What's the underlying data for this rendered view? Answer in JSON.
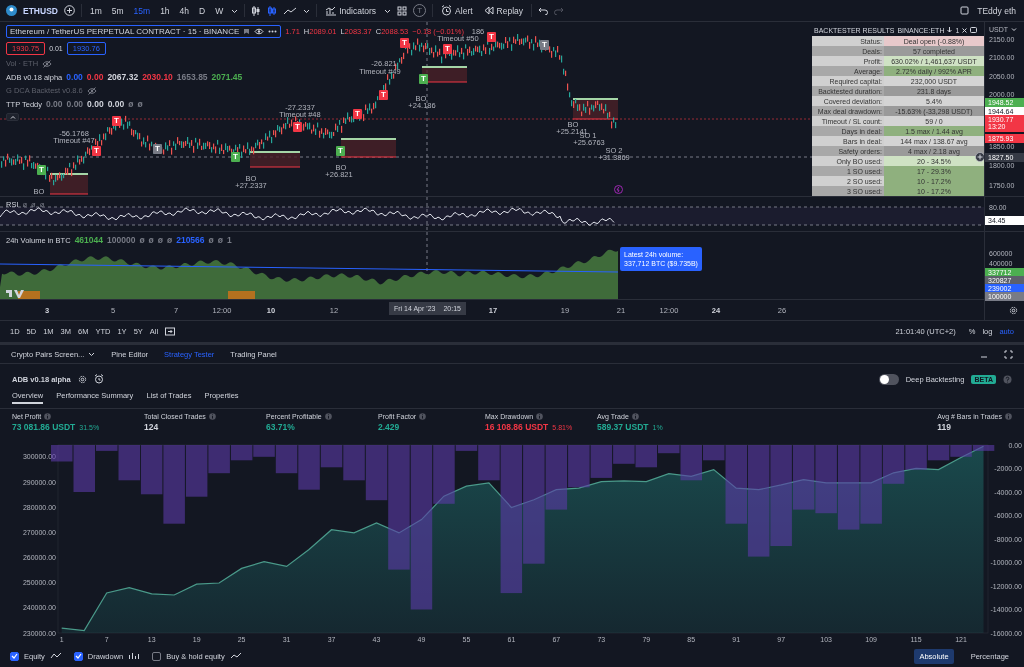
{
  "toolbar": {
    "symbol": "ETHUSD",
    "intervals": [
      {
        "label": "1m",
        "selected": false
      },
      {
        "label": "5m",
        "selected": false
      },
      {
        "label": "15m",
        "selected": true
      },
      {
        "label": "1h",
        "selected": false
      },
      {
        "label": "4h",
        "selected": false
      },
      {
        "label": "D",
        "selected": false
      },
      {
        "label": "W",
        "selected": false
      }
    ],
    "indicators_label": "Indicators",
    "templates_letter": "T",
    "alert_label": "Alert",
    "replay_label": "Replay",
    "user": "TEddy eth"
  },
  "chart": {
    "title": "Ethereum / TetherUS PERPETUAL CONTRACT · 15 · BINANCE",
    "open_fragment": "1.71",
    "ohlc": [
      {
        "label": "H",
        "value": "2089.01"
      },
      {
        "label": "L",
        "value": "2083.37"
      },
      {
        "label": "C",
        "value": "2088.53"
      }
    ],
    "change": "−0.18 (−0.01%)",
    "bid": "1930.75",
    "spread": "0.01",
    "ask": "1930.76",
    "indicators": [
      {
        "name": "Vol · ETH",
        "hidden": true
      },
      {
        "name": "ADB v0.18 alpha",
        "hidden": false,
        "values": [
          {
            "text": "0.00",
            "color": "#2962ff"
          },
          {
            "text": "0.00",
            "color": "#f23645"
          },
          {
            "text": "2067.32",
            "color": "#d1d4dc"
          },
          {
            "text": "2030.10",
            "color": "#f23645"
          },
          {
            "text": "1653.85",
            "color": "#787b86"
          },
          {
            "text": "2071.45",
            "color": "#4caf50"
          }
        ]
      },
      {
        "name": "G DCA Backtest v0.8.6",
        "hidden": true
      },
      {
        "name": "TTP Teddy",
        "hidden": false,
        "values": [
          {
            "text": "0.00",
            "color": "#787b86"
          },
          {
            "text": "0.00",
            "color": "#787b86"
          },
          {
            "text": "0.00",
            "color": "#d1d4dc"
          },
          {
            "text": "0.00",
            "color": "#d1d4dc"
          },
          {
            "text": "ø",
            "color": "#787b86"
          },
          {
            "text": "ø",
            "color": "#787b86"
          }
        ]
      }
    ],
    "annotations": [
      {
        "text": "-56.1768",
        "kind": "label"
      },
      {
        "text": "Timeout #47",
        "kind": "label"
      },
      {
        "text": "-27.2337",
        "kind": "label"
      },
      {
        "text": "Timeout #48",
        "kind": "label"
      },
      {
        "text": "-26.821",
        "kind": "label"
      },
      {
        "text": "Timeout #49",
        "kind": "label"
      },
      {
        "text": "186",
        "kind": "label"
      },
      {
        "text": "Timeout #50",
        "kind": "label"
      },
      {
        "text": "BO",
        "kind": "label"
      },
      {
        "text": "BO",
        "kind": "label"
      },
      {
        "text": "+27.2337",
        "kind": "label"
      },
      {
        "text": "BO",
        "kind": "label"
      },
      {
        "text": "+26.821",
        "kind": "label"
      },
      {
        "text": "BO",
        "kind": "label"
      },
      {
        "text": "+24.186",
        "kind": "label"
      },
      {
        "text": "BO",
        "kind": "label"
      },
      {
        "text": "+25.2141",
        "kind": "label"
      },
      {
        "text": "SO 1",
        "kind": "label"
      },
      {
        "text": "+25.6763",
        "kind": "label"
      },
      {
        "text": "SO 2",
        "kind": "label"
      },
      {
        "text": "+31.3869",
        "kind": "label"
      },
      {
        "text": "T",
        "kind": "marker",
        "color": "#f23645"
      },
      {
        "text": "T",
        "kind": "marker",
        "color": "#f23645"
      },
      {
        "text": "T",
        "kind": "marker",
        "color": "#f23645"
      },
      {
        "text": "T",
        "kind": "marker",
        "color": "#f23645"
      },
      {
        "text": "T",
        "kind": "marker",
        "color": "#f23645"
      },
      {
        "text": "T",
        "kind": "marker",
        "color": "#f23645"
      },
      {
        "text": "T",
        "kind": "marker",
        "color": "#f23645"
      },
      {
        "text": "T",
        "kind": "marker",
        "color": "#f23645"
      },
      {
        "text": "T",
        "kind": "marker",
        "color": "#787b86"
      },
      {
        "text": "T",
        "kind": "marker",
        "color": "#787b86"
      },
      {
        "text": "T",
        "kind": "marker",
        "color": "#4caf50"
      },
      {
        "text": "T",
        "kind": "marker",
        "color": "#4caf50"
      },
      {
        "text": "T",
        "kind": "marker",
        "color": "#4caf50"
      },
      {
        "text": "T",
        "kind": "marker",
        "color": "#4caf50"
      }
    ],
    "axis_currency": "USDT",
    "price_labels": [
      {
        "text": "2150.00",
        "kind": "plain"
      },
      {
        "text": "2100.00",
        "kind": "plain"
      },
      {
        "text": "2050.00",
        "kind": "plain"
      },
      {
        "text": "2000.00",
        "kind": "plain"
      },
      {
        "text": "1948.52",
        "kind": "tag",
        "color": "#4caf50"
      },
      {
        "text": "1944.64",
        "kind": "tag",
        "color": "#ffffff"
      },
      {
        "text": "1930.77",
        "sub": "13:20",
        "kind": "tag",
        "color": "#f23645"
      },
      {
        "text": "1875.93",
        "kind": "tag",
        "color": "#f23645"
      },
      {
        "text": "1850.00",
        "kind": "plain"
      },
      {
        "text": "1827.50",
        "kind": "tag",
        "color": "#363a45"
      },
      {
        "text": "1800.00",
        "kind": "plain"
      },
      {
        "text": "1750.00",
        "kind": "plain"
      }
    ]
  },
  "backtester": {
    "title": "BACKTESTER RESULTS",
    "symbol": "BINANCE:ETH",
    "pane_number": "1",
    "rows": [
      {
        "label": "Status:",
        "value": "Deal open (-0.88%)",
        "color": "#e8c9cb"
      },
      {
        "label": "Deals:",
        "value": "57 completed",
        "color": "#9a9a9a"
      },
      {
        "label": "Profit:",
        "value": "630.02% / 1,461,637 USDT",
        "color": "#cfe2c4"
      },
      {
        "label": "Average:",
        "value": "2.72% daily / 992% APR",
        "color": "#8fb07e"
      },
      {
        "label": "Required capital:",
        "value": "232,000 USDT",
        "color": "#d4d4d4"
      },
      {
        "label": "Backtested duration:",
        "value": "231.8 days",
        "color": "#9a9a9a"
      },
      {
        "label": "Covered deviation:",
        "value": "5.4%",
        "color": "#d4d4d4"
      },
      {
        "label": "Max deal drawdown:",
        "value": "-15.63% (-33,298 USDT)",
        "color": "#9a9a9a"
      },
      {
        "label": "Timeout / SL count:",
        "value": "59 / 0",
        "color": "#d4d4d4"
      },
      {
        "label": "Days in deal:",
        "value": "1.5 max / 1.44 avg",
        "color": "#8fb07e"
      },
      {
        "label": "Bars in deal:",
        "value": "144 max / 138.67 avg",
        "color": "#d4d4d4"
      },
      {
        "label": "Safety orders:",
        "value": "4 max / 2.18 avg",
        "color": "#9a9a9a"
      },
      {
        "label": "Only BO used:",
        "value": "20 - 34.5%",
        "color": "#cfe2c4"
      },
      {
        "label": "1 SO used:",
        "value": "17 - 29.3%",
        "color": "#8fb07e"
      },
      {
        "label": "2 SO used:",
        "value": "10 - 17.2%",
        "color": "#8fb07e"
      },
      {
        "label": "3 SO used:",
        "value": "10 - 17.2%",
        "color": "#8fb07e"
      }
    ]
  },
  "rsi": {
    "title": "RSI",
    "values": [
      "ø",
      "ø",
      "ø"
    ],
    "axis": [
      {
        "text": "80.00",
        "kind": "plain"
      },
      {
        "text": "34.45",
        "kind": "tag",
        "color": "#ffffff"
      }
    ]
  },
  "volume": {
    "title": "24h Volume in BTC",
    "values": [
      {
        "text": "461044",
        "color": "#4caf50"
      },
      {
        "text": "100000",
        "color": "#787b86"
      },
      {
        "text": "ø",
        "color": "#787b86"
      },
      {
        "text": "ø",
        "color": "#787b86"
      },
      {
        "text": "ø",
        "color": "#787b86"
      },
      {
        "text": "ø",
        "color": "#787b86"
      },
      {
        "text": "210566",
        "color": "#2962ff"
      },
      {
        "text": "ø",
        "color": "#787b86"
      },
      {
        "text": "ø",
        "color": "#787b86"
      },
      {
        "text": "1",
        "color": "#787b86"
      }
    ],
    "tooltip_title": "Latest 24h volume:",
    "tooltip_text": "337,712 BTC ($9.735B)",
    "axis": [
      {
        "text": "600000",
        "kind": "plain"
      },
      {
        "text": "400000",
        "kind": "plain"
      },
      {
        "text": "337712",
        "kind": "tag",
        "color": "#4caf50"
      },
      {
        "text": "320827",
        "kind": "tag",
        "color": "#5d606b"
      },
      {
        "text": "239002",
        "kind": "tag",
        "color": "#2962ff"
      },
      {
        "text": "100000",
        "kind": "tag",
        "color": "#787b86"
      }
    ]
  },
  "time_axis": {
    "labels": [
      {
        "text": "3",
        "kind": "major"
      },
      {
        "text": "5",
        "kind": "minor"
      },
      {
        "text": "7",
        "kind": "minor"
      },
      {
        "text": "12:00",
        "kind": "minor"
      },
      {
        "text": "10",
        "kind": "major"
      },
      {
        "text": "12",
        "kind": "minor"
      },
      {
        "text": "17",
        "kind": "major"
      },
      {
        "text": "19",
        "kind": "minor"
      },
      {
        "text": "21",
        "kind": "minor"
      },
      {
        "text": "12:00",
        "kind": "minor"
      },
      {
        "text": "24",
        "kind": "major"
      },
      {
        "text": "26",
        "kind": "minor"
      }
    ],
    "crosshair_date": "Fri 14 Apr '23",
    "crosshair_time": "20:15"
  },
  "range_bar": {
    "ranges": [
      "1D",
      "5D",
      "1M",
      "3M",
      "6M",
      "YTD",
      "1Y",
      "5Y",
      "All"
    ],
    "clock": "21:01:40 (UTC+2)",
    "scale_options": [
      {
        "label": "%",
        "selected": false
      },
      {
        "label": "log",
        "selected": false
      },
      {
        "label": "auto",
        "selected": true
      }
    ]
  },
  "bottom_panel": {
    "tabs": [
      {
        "label": "Crypto Pairs Screen...",
        "selected": false,
        "kind": "dropdown"
      },
      {
        "label": "Pine Editor",
        "selected": false,
        "kind": "plain"
      },
      {
        "label": "Strategy Tester",
        "selected": true,
        "kind": "plain"
      },
      {
        "label": "Trading Panel",
        "selected": false,
        "kind": "plain"
      }
    ],
    "strategy": {
      "name": "ADB v0.18 alpha",
      "deep_backtesting": {
        "label": "Deep Backtesting",
        "on": false,
        "badge": "BETA"
      },
      "subtabs": [
        {
          "label": "Overview",
          "selected": true
        },
        {
          "label": "Performance Summary",
          "selected": false
        },
        {
          "label": "List of Trades",
          "selected": false
        },
        {
          "label": "Properties",
          "selected": false
        }
      ],
      "metrics": [
        {
          "label": "Net Profit",
          "value": "73 081.86 USDT",
          "extra": "31.5%",
          "color": "#22ab94"
        },
        {
          "label": "Total Closed Trades",
          "value": "124",
          "color": "#d1d4dc"
        },
        {
          "label": "Percent Profitable",
          "value": "63.71%",
          "color": "#22ab94"
        },
        {
          "label": "Profit Factor",
          "value": "2.429",
          "color": "#22ab94"
        },
        {
          "label": "Max Drawdown",
          "value": "16 108.86 USDT",
          "extra": "5.81%",
          "color": "#f23645"
        },
        {
          "label": "Avg Trade",
          "value": "589.37 USDT",
          "extra": "1%",
          "color": "#22ab94"
        },
        {
          "label": "Avg # Bars in Trades",
          "value": "119",
          "color": "#d1d4dc"
        }
      ],
      "equity_chart": {
        "chart_data": {
          "type": "area",
          "xlim": [
            0.5,
            124.6
          ],
          "ylim": [
            230000,
            304770
          ],
          "x": [
            1,
            4,
            7,
            10,
            13,
            16,
            19,
            22,
            25,
            28,
            31,
            34,
            37,
            40,
            43,
            46,
            49,
            52,
            55,
            58,
            61,
            64,
            67,
            70,
            73,
            76,
            79,
            82,
            85,
            88,
            91,
            94,
            97,
            100,
            103,
            106,
            109,
            112,
            115,
            118,
            121,
            124
          ],
          "xticks": [
            1,
            7,
            13,
            19,
            25,
            31,
            37,
            43,
            49,
            55,
            61,
            67,
            73,
            79,
            85,
            91,
            97,
            103,
            109,
            115,
            121
          ],
          "yticks": [
            {
              "value": 230000,
              "label": "230000.00"
            },
            {
              "value": 240000,
              "label": "240000.00"
            },
            {
              "value": 250000,
              "label": "250000.00"
            },
            {
              "value": 260000,
              "label": "260000.00"
            },
            {
              "value": 270000,
              "label": "270000.00"
            },
            {
              "value": 280000,
              "label": "280000.00"
            },
            {
              "value": 290000,
              "label": "290000.00"
            },
            {
              "value": 300000,
              "label": "300000.00"
            }
          ],
          "series": [
            {
              "color": "#4a9a8a",
              "values": [
                231900,
                231000,
                245900,
                248000,
                245600,
                245100,
                249400,
                249900,
                255700,
                258400,
                256500,
                263200,
                271100,
                269800,
                273800,
                269800,
                275100,
                284400,
                288400,
                289700,
                279900,
                283000,
                287000,
                287600,
                290200,
                290500,
                290200,
                293400,
                292300,
                295000,
                287600,
                287000,
                288900,
                291000,
                289700,
                289700,
                289700,
                293700,
                295500,
                295000,
                299800,
                304300
              ]
            }
          ]
        }
      },
      "drawdown_chart": {
        "chart_data": {
          "type": "bar",
          "xlim": [
            0.5,
            124.6
          ],
          "ylim": [
            -16000,
            0
          ],
          "x": [
            1,
            4,
            7,
            10,
            13,
            16,
            19,
            22,
            25,
            28,
            31,
            34,
            37,
            40,
            43,
            46,
            49,
            52,
            55,
            58,
            61,
            64,
            67,
            70,
            73,
            76,
            79,
            82,
            85,
            88,
            91,
            94,
            97,
            100,
            103,
            106,
            109,
            112,
            115,
            118,
            121,
            124
          ],
          "yticks": [
            {
              "value": 0,
              "label": "0.00"
            },
            {
              "value": -2000,
              "label": "-2000.00"
            },
            {
              "value": -4000,
              "label": "-4000.00"
            },
            {
              "value": -6000,
              "label": "-6000.00"
            },
            {
              "value": -8000,
              "label": "-8000.00"
            },
            {
              "value": -10000,
              "label": "-10000.00"
            },
            {
              "value": -12000,
              "label": "-12000.00"
            },
            {
              "value": -14000,
              "label": "-14000.00"
            },
            {
              "value": -16000,
              "label": "-16000.00"
            }
          ],
          "series": [
            {
              "color": "#5b3aa8",
              "values": [
                -1400,
                -4000,
                -500,
                -3000,
                -4200,
                -6700,
                -4400,
                -2400,
                -1300,
                -1000,
                -2400,
                -3800,
                -1900,
                -3000,
                -4700,
                -10600,
                -14000,
                -5000,
                -500,
                -3000,
                -12600,
                -10100,
                -5500,
                -3600,
                -2800,
                -1600,
                -1900,
                -700,
                -3000,
                -1300,
                -6700,
                -9500,
                -8600,
                -5500,
                -5800,
                -7200,
                -6700,
                -3300,
                -2100,
                -1300,
                -1000,
                -500
              ]
            }
          ]
        }
      },
      "legend": [
        {
          "label": "Equity",
          "checked": true
        },
        {
          "label": "Drawdown",
          "checked": true
        },
        {
          "label": "Buy & hold equity",
          "checked": false
        }
      ],
      "scale_buttons": [
        {
          "label": "Absolute",
          "selected": true
        },
        {
          "label": "Percentage",
          "selected": false
        }
      ]
    }
  }
}
